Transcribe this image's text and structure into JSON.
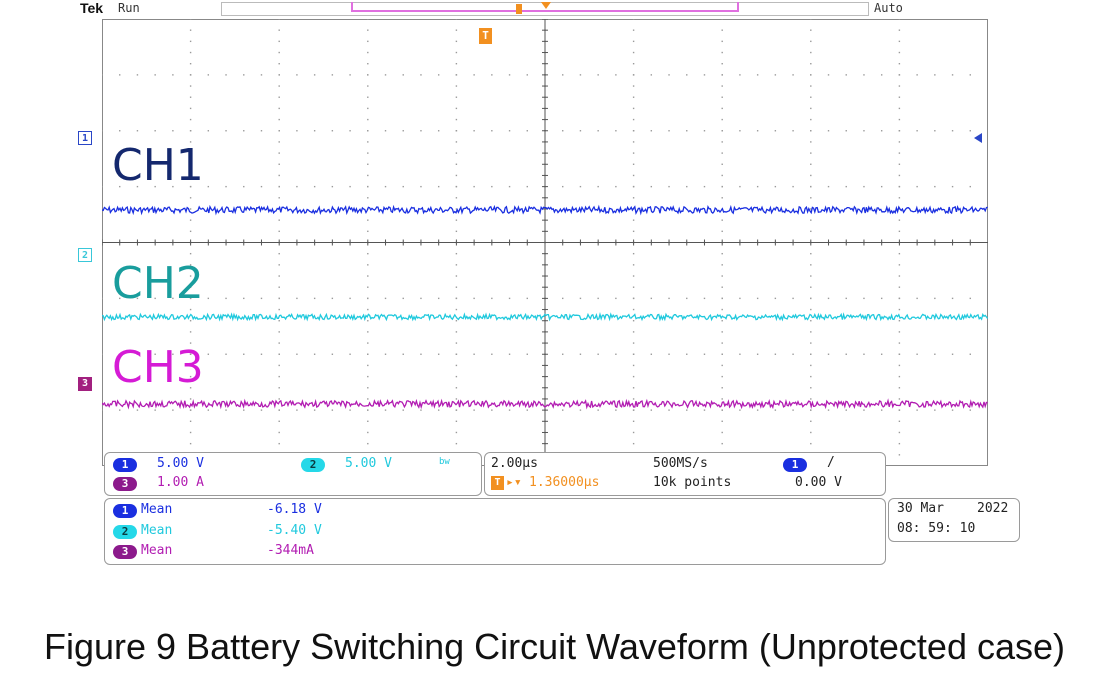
{
  "topbar": {
    "brand": "Tek",
    "run_state": "Run",
    "trigger_mode": "Auto"
  },
  "overlay_labels": {
    "ch1": "CH1",
    "ch2": "CH2",
    "ch3": "CH3"
  },
  "ground_markers": {
    "ch1": "1",
    "ch2": "2",
    "ch3": "3",
    "trigger_position": "T"
  },
  "channels_panel": {
    "ch1_badge": "1",
    "ch1_scale": "5.00 V",
    "ch2_badge": "2",
    "ch2_scale": "5.00 V",
    "ch2_bw": "bw",
    "ch3_badge": "3",
    "ch3_scale": "1.00 A"
  },
  "horizontal_panel": {
    "time_div": "2.00µs",
    "trigger_pos_badge": "T",
    "trigger_pos": "1.36000µs",
    "sample_rate": "500MS/s",
    "record_length": "10k points",
    "trig_source_badge": "1",
    "trig_slope": "/",
    "trig_level": "0.00 V"
  },
  "measurements": [
    {
      "badge": "1",
      "label": "Mean",
      "value": "-6.18 V"
    },
    {
      "badge": "2",
      "label": "Mean",
      "value": "-5.40 V"
    },
    {
      "badge": "3",
      "label": "Mean",
      "value": "-344mA"
    }
  ],
  "datetime": {
    "date": "30 Mar",
    "year": "2022",
    "time": "08: 59: 10"
  },
  "colors": {
    "ch1": "#1a2fe0",
    "ch2": "#20c9dd",
    "ch3": "#b21db2",
    "trigger": "#f29020"
  },
  "caption": "Figure 9 Battery Switching Circuit Waveform (Unprotected case)"
}
